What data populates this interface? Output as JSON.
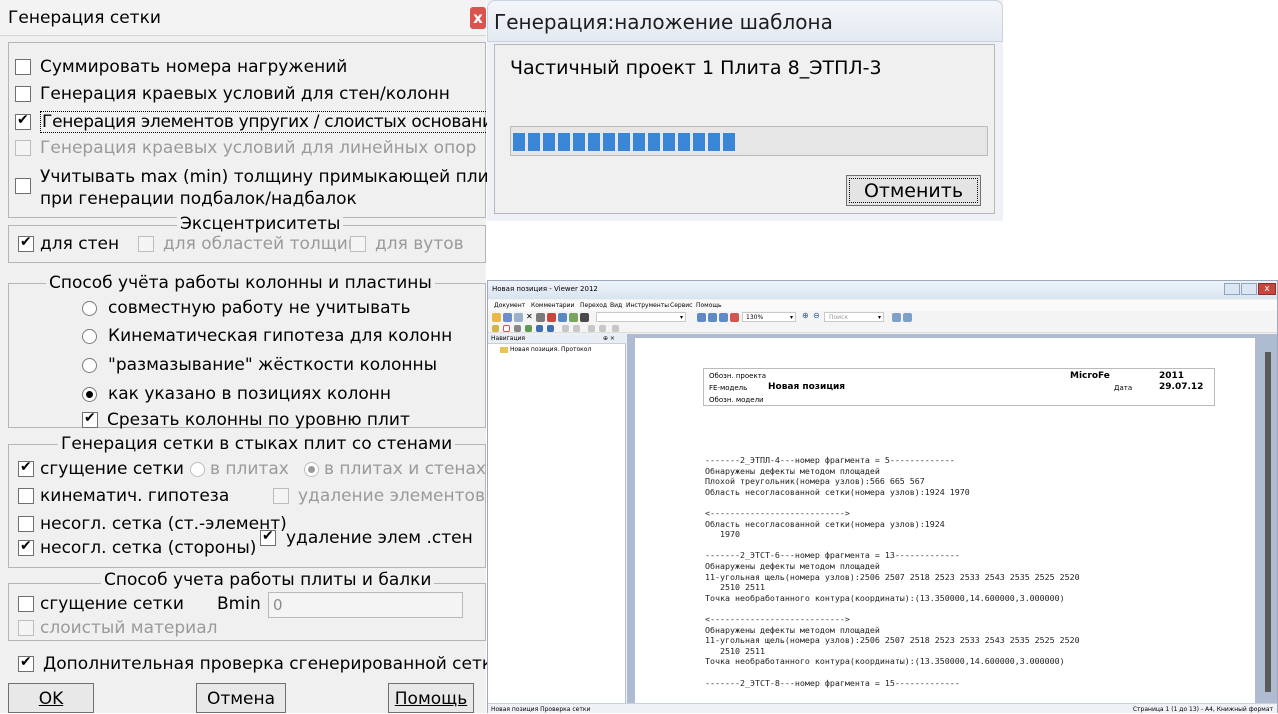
{
  "mesh_dialog": {
    "title": "Генерация сетки",
    "close_glyph": "x",
    "options": [
      {
        "label": "Суммировать номера нагружений",
        "checked": false,
        "enabled": true
      },
      {
        "label": "Генерация краевых условий  для стен/колонн",
        "checked": false,
        "enabled": true
      },
      {
        "label": "Генерация элементов упругих / слоистых оснований",
        "checked": true,
        "enabled": true
      },
      {
        "label": "Генерация краевых условий для линейных опор",
        "checked": false,
        "enabled": false
      },
      {
        "label_line1": "Учитывать max (min) толщину примыкающей плиты",
        "label_line2": "при генерации подбалок/надбалок",
        "checked": false,
        "enabled": true
      }
    ],
    "eccentricities": {
      "legend": "Эксцентриситеты",
      "walls": {
        "label": "для стен",
        "checked": true,
        "enabled": true
      },
      "thickness_areas": {
        "label": "для областей толщин",
        "checked": false,
        "enabled": false
      },
      "vuts": {
        "label": "для вутов",
        "checked": false,
        "enabled": false
      }
    },
    "column_plate": {
      "legend": "Способ учёта работы колонны и пластины",
      "radios": [
        {
          "label": "совместную работу не учитывать",
          "selected": false
        },
        {
          "label": "Кинематическая гипотеза для колонн",
          "selected": false
        },
        {
          "label": "\"размазывание\" жёсткости колонны",
          "selected": false
        },
        {
          "label": "как указано  в позициях колонн",
          "selected": true
        }
      ],
      "cut_columns": {
        "label": "Срезать колонны по уровню плит",
        "checked": true
      }
    },
    "joints": {
      "legend": "Генерация сетки в стыках плит со стенами",
      "refine": {
        "label": "сгущение сетки",
        "checked": true
      },
      "in_plates": {
        "label": "в плитах",
        "selected": false
      },
      "in_plates_walls": {
        "label": "в плитах и стенах",
        "selected": true
      },
      "kinematic": {
        "label": "кинематич. гипотеза",
        "checked": false
      },
      "delete_elements": {
        "label": "удаление элементов",
        "checked": false
      },
      "mismatch_wall": {
        "label": "несогл. сетка (ст.-элемент)",
        "checked": false
      },
      "mismatch_sides": {
        "label": "несогл. сетка (стороны)",
        "checked": true
      },
      "delete_wall_elems": {
        "label": "удаление элем .стен",
        "checked": true
      }
    },
    "plate_beam": {
      "legend": "Способ учета работы плиты и балки",
      "refine": {
        "label": "сгущение сетки",
        "checked": false
      },
      "bmin_label": "Bmin",
      "bmin_value": "0",
      "layered": {
        "label": "слоистый материал",
        "checked": false
      }
    },
    "extra_check": {
      "label": "Дополнительная проверка сгенерированной сетки",
      "checked": true
    },
    "buttons": {
      "ok": "OK",
      "cancel": "Отмена",
      "help": "Помощь"
    }
  },
  "progress_dialog": {
    "title": "Генерация:наложение шаблона",
    "message": "Частичный проект 1 Плита 8_ЭТПЛ-3",
    "progress_percent": 47,
    "cancel_label": "Отменить"
  },
  "viewer": {
    "title": "Новая позиция - Viewer 2012",
    "menu": [
      "Документ",
      "Комментарии",
      "Переход",
      "Вид",
      "Инструменты",
      "Сервис",
      "Помощь"
    ],
    "zoom": "130%",
    "search_placeholder": "Поиск",
    "nav_title": "Навигация",
    "nav_pin": "⊕ ×",
    "nav_item": "Новая позиция. Протокол",
    "page_header": {
      "project_label": "Обозн. проекта",
      "app": "MicroFe",
      "year": "2011",
      "model_label": "FE-модель",
      "position": "Новая позиция",
      "date_label": "Дата",
      "date": "29.07.12",
      "model_id_label": "Обозн. модели"
    },
    "log_lines": [
      "-------2_ЭТПЛ-4---номер фрагмента = 5-------------",
      "Обнаружены дефекты методом площадей",
      "Плохой треугольник(номера узлов):566 665 567",
      "Область несогласованной сетки(номера узлов):1924 1970",
      "",
      "<--------------------------->",
      "Область несогласованной сетки(номера узлов):1924",
      "   1970",
      "",
      "-------2_ЭТСТ-6---номер фрагмента = 13-------------",
      "Обнаружены дефекты методом площадей",
      "11-угольная щель(номера узлов):2506 2507 2518 2523 2533 2543 2535 2525 2520",
      "   2510 2511",
      "Точка необработанного контура(координаты):(13.350000,14.600000,3.000000)",
      "",
      "<--------------------------->",
      "Обнаружены дефекты методом площадей",
      "11-угольная щель(номера узлов):2506 2507 2518 2523 2533 2543 2535 2525 2520",
      "   2510 2511",
      "Точка необработанного контура(координаты):(13.350000,14.600000,3.000000)",
      "",
      "-------2_ЭТСТ-8---номер фрагмента = 15-------------"
    ],
    "status_left": "Новая позиция  Проверка сетки",
    "status_right": "Страница 1 (1 до 13) - A4, Книжный формат"
  }
}
